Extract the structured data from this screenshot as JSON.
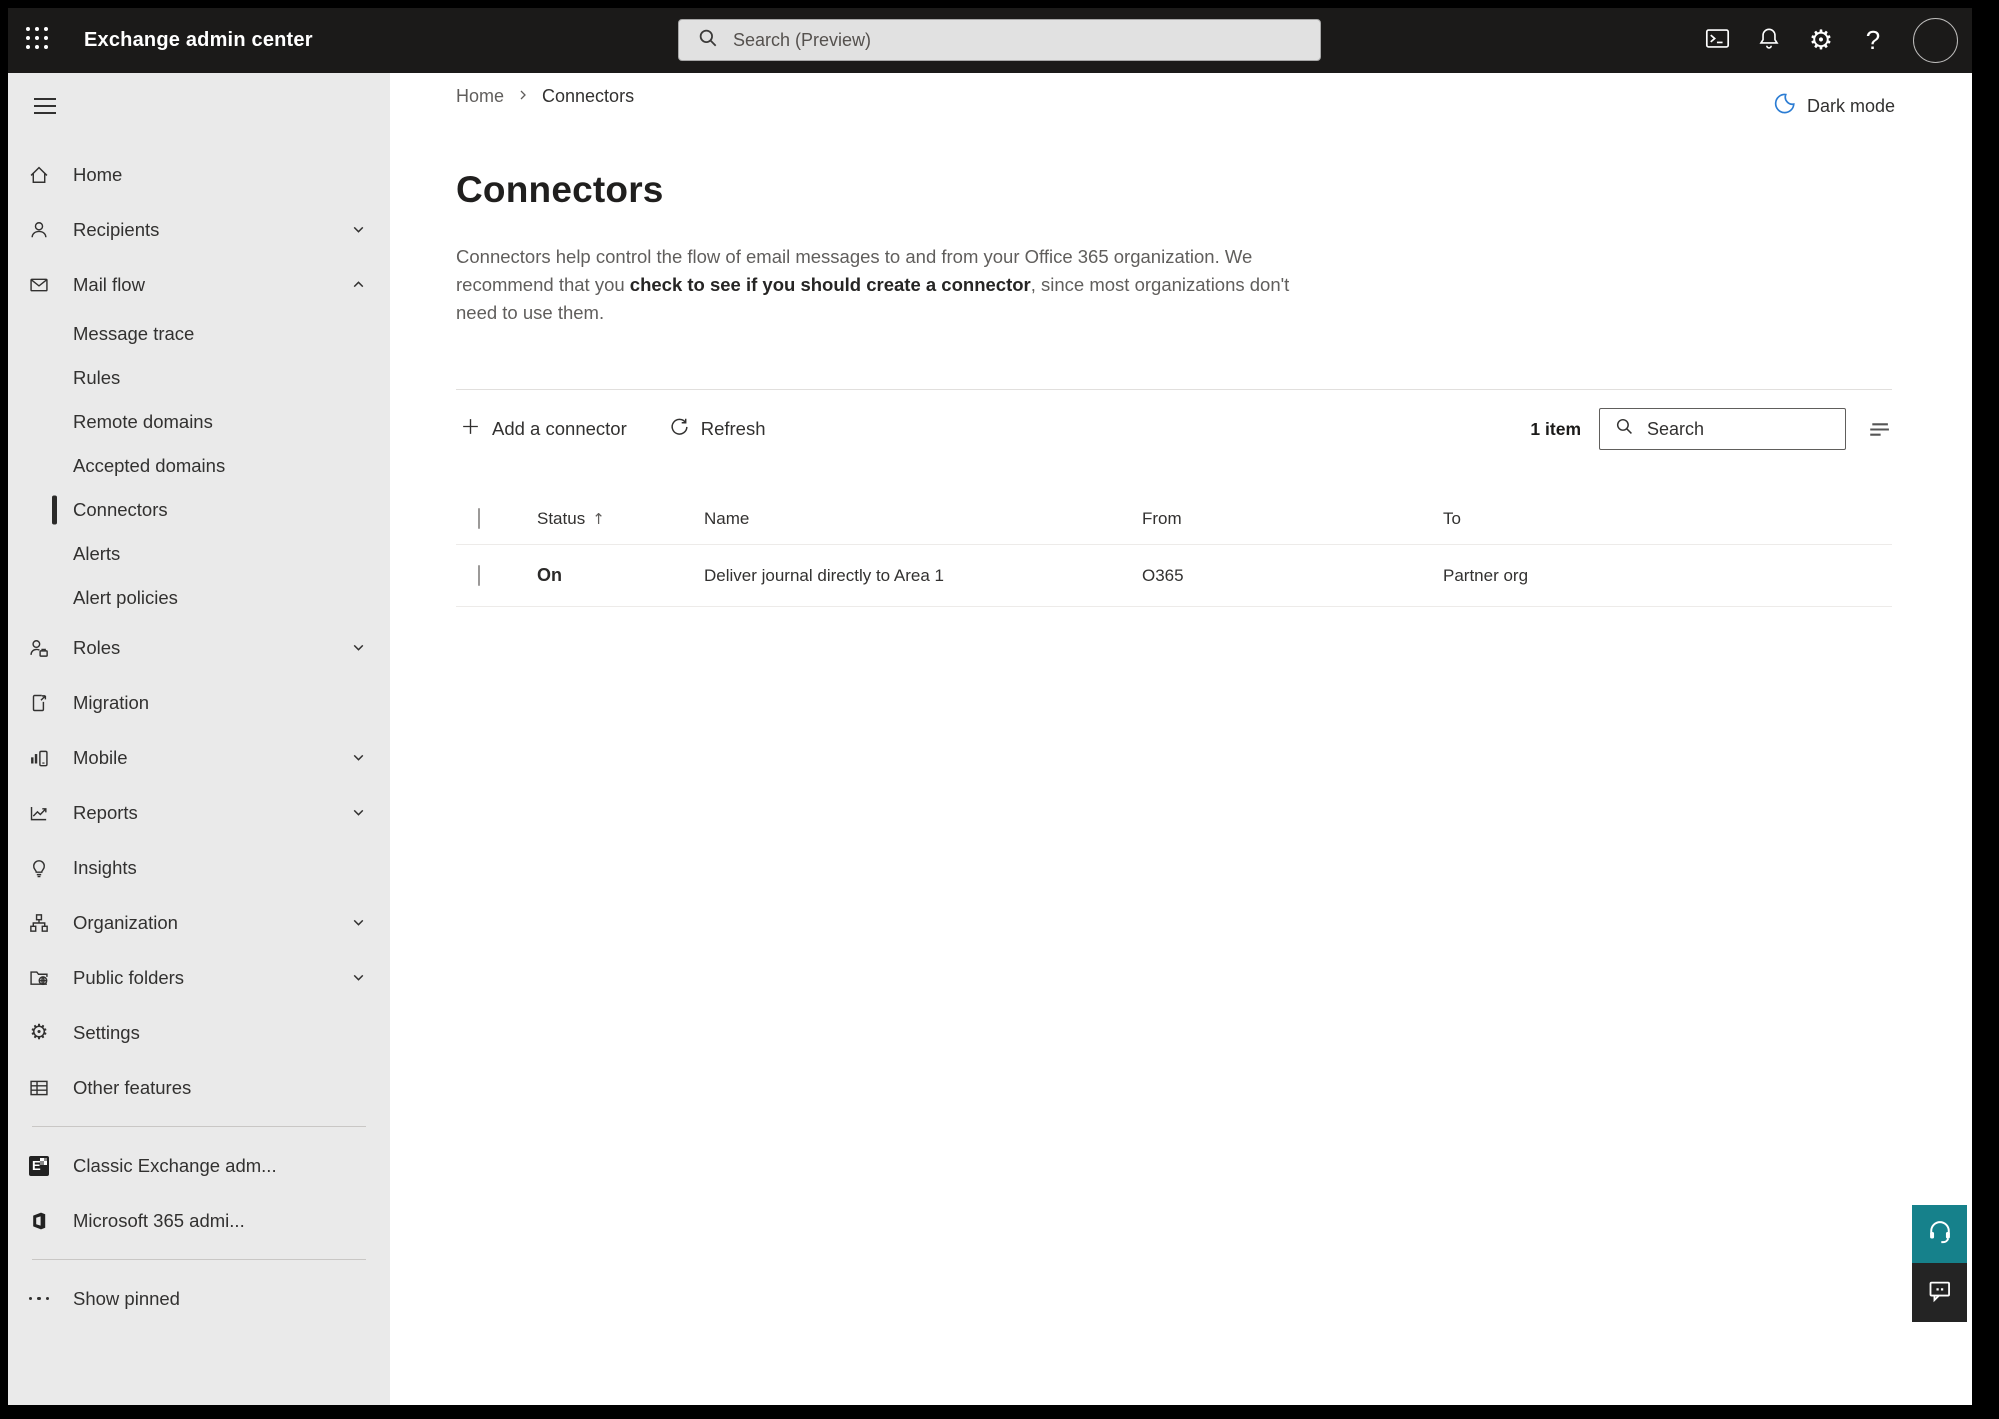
{
  "topbar": {
    "app_title": "Exchange admin center",
    "search_placeholder": "Search (Preview)",
    "help_label": "?",
    "gear_glyph": "⚙"
  },
  "breadcrumb": {
    "home": "Home",
    "current": "Connectors"
  },
  "dark_mode_label": "Dark mode",
  "page": {
    "title": "Connectors",
    "description_1": "Connectors help control the flow of email messages to and from your Office 365 organization. We recommend that you ",
    "description_link": "check to see if you should create a connector",
    "description_2": ", since most organizations don't need to use them."
  },
  "toolbar": {
    "add_label": "Add a connector",
    "refresh_label": "Refresh",
    "item_count": "1 item",
    "search_placeholder": "Search"
  },
  "table": {
    "columns": {
      "status": "Status",
      "name": "Name",
      "from": "From",
      "to": "To"
    },
    "sort_arrow": "↑",
    "rows": [
      {
        "status": "On",
        "name": "Deliver journal directly to Area 1",
        "from": "O365",
        "to": "Partner org"
      }
    ]
  },
  "sidebar": {
    "items": [
      {
        "label": "Home"
      },
      {
        "label": "Recipients"
      },
      {
        "label": "Mail flow"
      },
      {
        "label": "Message trace"
      },
      {
        "label": "Rules"
      },
      {
        "label": "Remote domains"
      },
      {
        "label": "Accepted domains"
      },
      {
        "label": "Connectors"
      },
      {
        "label": "Alerts"
      },
      {
        "label": "Alert policies"
      },
      {
        "label": "Roles"
      },
      {
        "label": "Migration"
      },
      {
        "label": "Mobile"
      },
      {
        "label": "Reports"
      },
      {
        "label": "Insights"
      },
      {
        "label": "Organization"
      },
      {
        "label": "Public folders"
      },
      {
        "label": "Settings"
      },
      {
        "label": "Other features"
      },
      {
        "label": "Classic Exchange adm...",
        "logo_letter": "E"
      },
      {
        "label": "Microsoft 365 admi..."
      },
      {
        "label": "Show pinned"
      }
    ]
  },
  "colors": {
    "topbar_bg": "#1b1a19",
    "sidebar_bg": "#eaeaea",
    "accent_teal": "#16818b",
    "moon_blue": "#2b7cd3",
    "text_primary": "#323130",
    "text_secondary": "#605e5c"
  }
}
